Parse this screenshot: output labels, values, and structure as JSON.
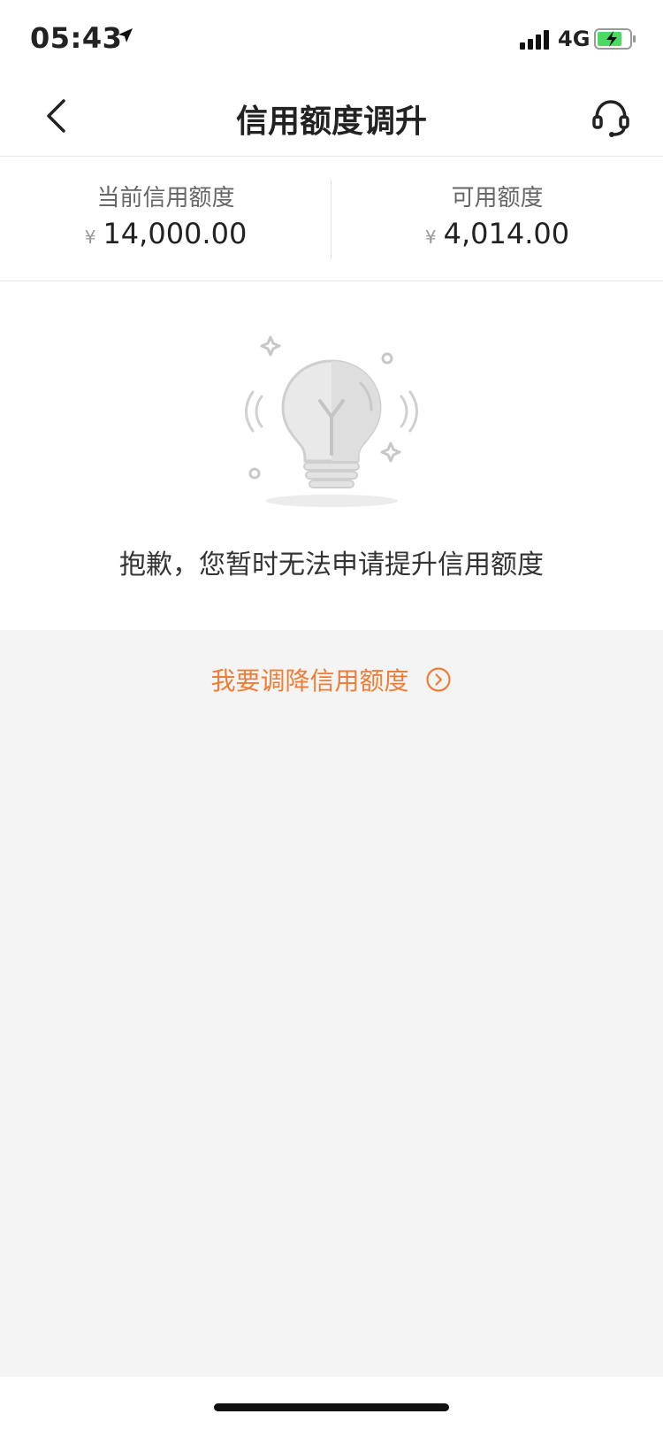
{
  "status_bar": {
    "time": "05:43",
    "network": "4G"
  },
  "nav": {
    "title": "信用额度调升",
    "back_icon": "chevron-left-icon",
    "support_icon": "headset-icon"
  },
  "credit": {
    "current_label": "当前信用额度",
    "current_currency": "¥",
    "current_amount": "14,000.00",
    "available_label": "可用额度",
    "available_currency": "¥",
    "available_amount": "4,014.00"
  },
  "empty_state": {
    "icon": "lightbulb-icon",
    "message": "抱歉，您暂时无法申请提升信用额度"
  },
  "reduce": {
    "label": "我要调降信用额度",
    "icon": "circle-chevron-right-icon"
  },
  "colors": {
    "accent": "#ee7e36",
    "background": "#f4f4f4",
    "battery": "#4cd964"
  }
}
